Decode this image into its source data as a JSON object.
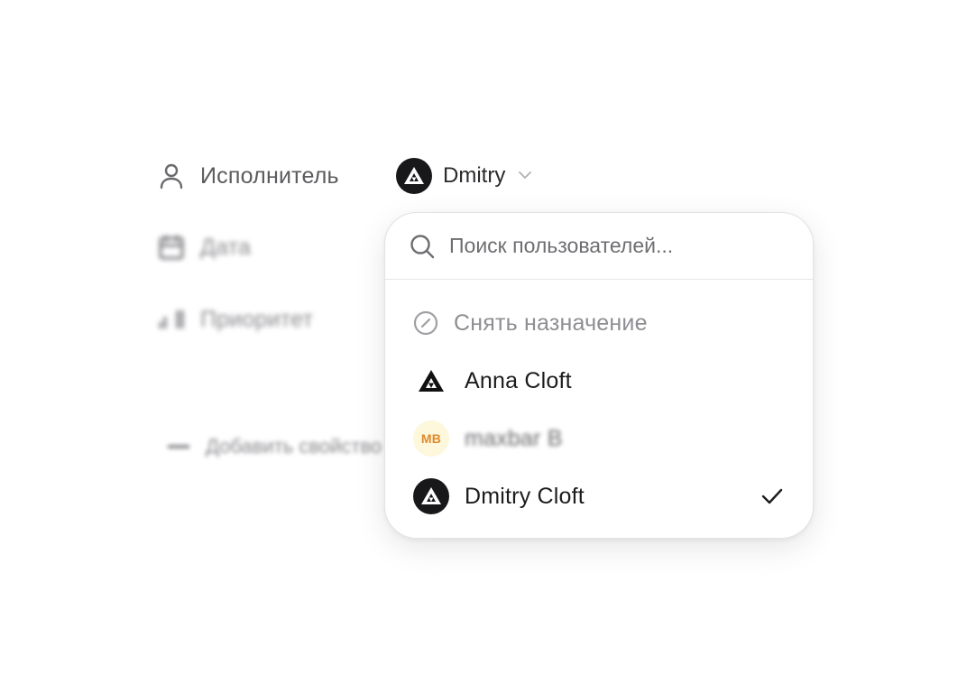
{
  "properties": {
    "assignee_label": "Исполнитель",
    "assignee_value": "Dmitry",
    "date_label": "Дата",
    "priority_label": "Приоритет",
    "add_property_text": "Добавить свойство"
  },
  "dropdown": {
    "search_placeholder": "Поиск пользователей...",
    "search_value": "",
    "unassign_label": "Снять назначение",
    "users": [
      {
        "name": "Anna Cloft",
        "avatar": "triangle-logo-icon",
        "selected": false
      },
      {
        "name": "maxbar B",
        "avatar_initials": "MB",
        "selected": false
      },
      {
        "name": "Dmitry Cloft",
        "avatar": "dark-logo-avatar",
        "selected": true
      }
    ]
  },
  "colors": {
    "mb_avatar_bg": "#fdf7dc",
    "mb_avatar_text": "#e08a2c",
    "dark_avatar_bg": "#18181a"
  }
}
